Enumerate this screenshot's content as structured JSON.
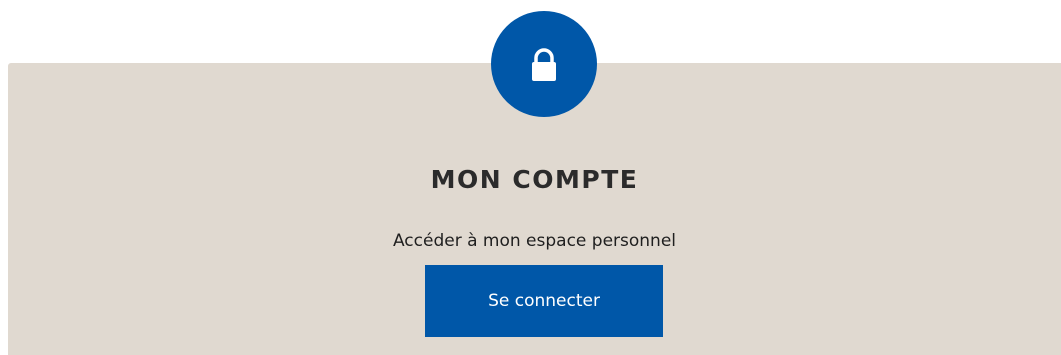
{
  "account": {
    "icon": "lock-icon",
    "title": "MON COMPTE",
    "subtitle": "Accéder à mon espace personnel",
    "button_label": "Se connecter"
  },
  "colors": {
    "primary": "#0057a8",
    "panel_background": "#e0d9d0",
    "text_dark": "#2b2b2b",
    "button_text": "#ffffff"
  }
}
